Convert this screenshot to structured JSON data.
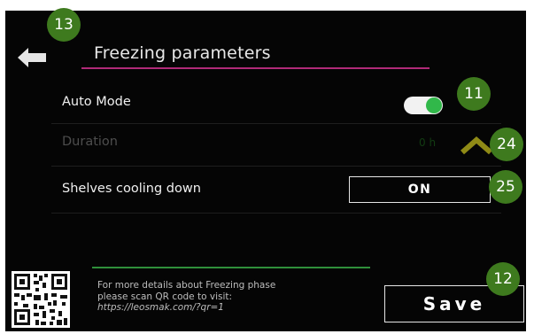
{
  "screen": {
    "title": "Freezing parameters",
    "back_icon": "back-arrow-icon"
  },
  "settings": {
    "auto_mode": {
      "label": "Auto Mode",
      "toggle_on": true
    },
    "duration": {
      "label": "Duration",
      "value": "0 h",
      "icon": "chevron-up-icon",
      "disabled": true
    },
    "shelves": {
      "label": "Shelves cooling down",
      "value": "ON"
    }
  },
  "footer": {
    "info_line1": "For more details about Freezing phase",
    "info_line2": "please scan QR code to visit:",
    "info_url": "https://leosmak.com/?qr=1",
    "qr_icon": "qr-code-icon",
    "save_label": "Save"
  },
  "callouts": {
    "back": "13",
    "auto_mode": "11",
    "duration": "24",
    "shelves": "25",
    "save": "12"
  },
  "colors": {
    "background": "#050505",
    "title_underline": "#b02a78",
    "toggle_knob": "#31b84a",
    "chevron": "#8f8a16",
    "footer_line": "#2f8f3a",
    "callout": "#3e7a1e"
  }
}
